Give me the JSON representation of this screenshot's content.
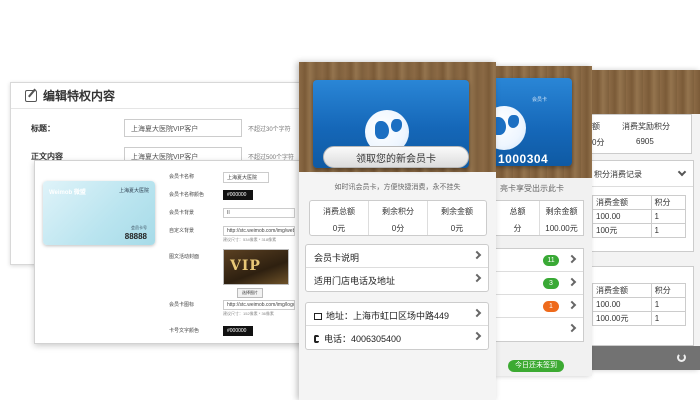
{
  "editor": {
    "title": "编辑特权内容",
    "fields": [
      {
        "label": "标题：",
        "value": "上海夏大医院VIP客户",
        "hint": "不超过30个字符"
      },
      {
        "label": "正文内容",
        "value": "上海夏大医院VIP客户",
        "hint": "不超过500个字符"
      }
    ]
  },
  "card_editor": {
    "preview": {
      "logo": "Weimob 微盟",
      "name": "上海夏大医院",
      "card_label": "会员卡号",
      "card_no": "88888"
    },
    "rows": [
      {
        "label": "会员卡名称",
        "value": "上海夏大医院",
        "style": "plain"
      },
      {
        "label": "会员卡名称颜色",
        "value": "#000000",
        "style": "dark"
      },
      {
        "label": "会员卡背景",
        "value": "II",
        "style": "plain"
      },
      {
        "label": "自定义背景",
        "value": "http://stc.weimob.com/img/web_bkt",
        "style": "plain"
      },
      {
        "label": "图文活动封面",
        "value": "",
        "style": "none"
      },
      {
        "label": "会员卡图标",
        "value": "http://stc.weimob.com/img/logo.png",
        "style": "plain"
      },
      {
        "label": "卡号文字颜色",
        "value": "#000000",
        "style": "dark"
      }
    ],
    "bg_note": "建议尺寸：534像素 * 318像素",
    "icon_note": "建议尺寸：152像素 * 36像素",
    "vip_text": "VIP",
    "upload_label": "选择图片"
  },
  "phone1": {
    "claim_button": "领取您的新会员卡",
    "subtitle": "如时讯会员卡，方便快捷消费，永不挂失",
    "stats": [
      {
        "label": "消费总额",
        "value": "0元"
      },
      {
        "label": "剩余积分",
        "value": "0分"
      },
      {
        "label": "剩余金额",
        "value": "0元"
      }
    ],
    "menu_a": [
      "会员卡说明",
      "适用门店电话及地址"
    ],
    "menu_b": [
      "地址：上海市虹口区场中路449",
      "电话：4006305400"
    ]
  },
  "phone2": {
    "card_tag": "会员卡",
    "card_no": "1000304",
    "subtitle": "亮卡享受出示此卡",
    "stats": [
      {
        "label": "总额",
        "value": "分"
      },
      {
        "label": "剩余金额",
        "value": "100.00元"
      }
    ],
    "badges": [
      {
        "value": "11",
        "color": "#39a935"
      },
      {
        "value": "3",
        "color": "#39a935"
      },
      {
        "value": "1",
        "color": "#ee6a1b"
      },
      {
        "value": "",
        "color": ""
      }
    ],
    "sign_button": "今日还未签到"
  },
  "phone3": {
    "top_labels": [
      "额",
      "消费奖励积分"
    ],
    "top_values": [
      "0分",
      "6905"
    ],
    "box1_title": "积分消费记录",
    "box1_header": [
      "消费金额",
      "积分"
    ],
    "box1_rows": [
      [
        "100.00",
        "1"
      ],
      [
        "100元",
        "1"
      ]
    ],
    "box2_header": [
      "消费金额",
      "积分"
    ],
    "box2_rows": [
      [
        "100.00",
        "1"
      ],
      [
        "100.00元",
        "1"
      ]
    ]
  },
  "colors": {
    "card_blue": "#1567b8",
    "green": "#39a935",
    "orange": "#ee6a1b"
  }
}
